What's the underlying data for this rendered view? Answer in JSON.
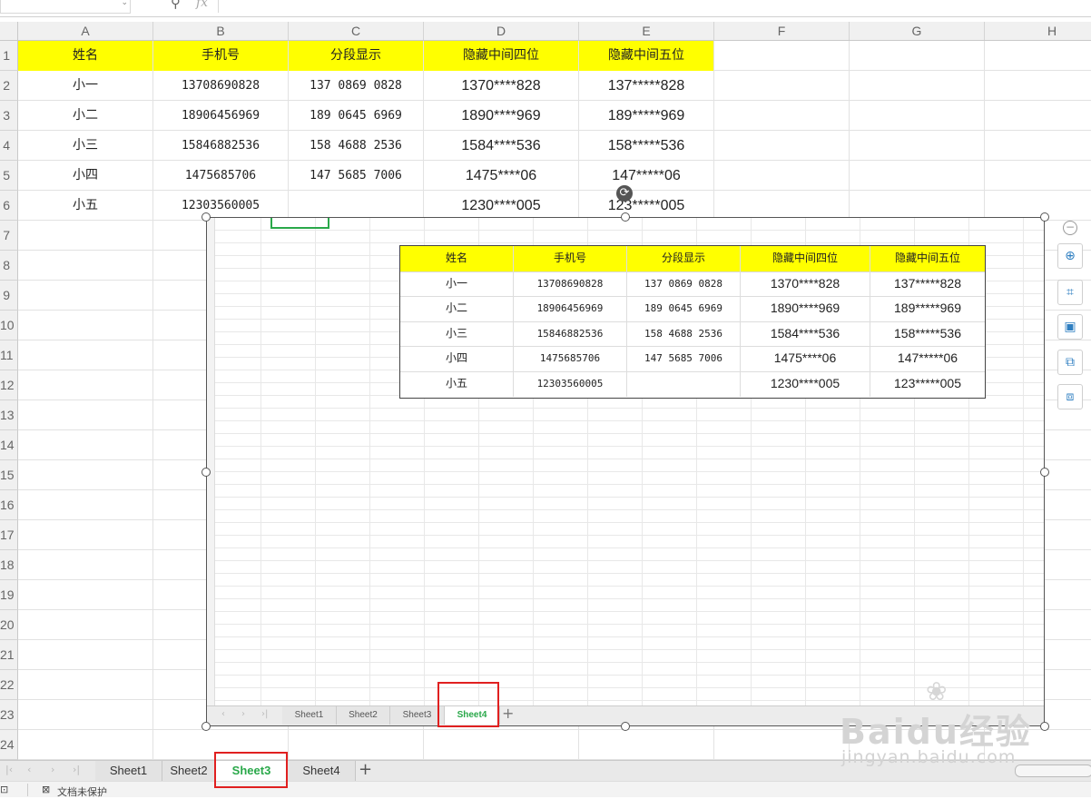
{
  "formula_bar": {
    "fx": "fx"
  },
  "columns": [
    "A",
    "B",
    "C",
    "D",
    "E",
    "F",
    "G",
    "H"
  ],
  "rows": [
    "1",
    "2",
    "3",
    "4",
    "5",
    "6",
    "7",
    "8",
    "9",
    "10",
    "11",
    "12",
    "13",
    "14",
    "15",
    "16",
    "17",
    "18",
    "19",
    "20",
    "21",
    "22",
    "23",
    "24"
  ],
  "table": {
    "headers": [
      "姓名",
      "手机号",
      "分段显示",
      "隐藏中间四位",
      "隐藏中间五位"
    ],
    "rows": [
      [
        "小一",
        "13708690828",
        "137 0869 0828",
        "1370****828",
        "137*****828"
      ],
      [
        "小二",
        "18906456969",
        "189 0645 6969",
        "1890****969",
        "189*****969"
      ],
      [
        "小三",
        "15846882536",
        "158 4688 2536",
        "1584****536",
        "158*****536"
      ],
      [
        "小四",
        "1475685706",
        "147 5685 7006",
        "1475****06",
        "147*****06"
      ],
      [
        "小五",
        "12303560005",
        "",
        "1230****005",
        "123*****005"
      ]
    ]
  },
  "picture": {
    "tabs": [
      "Sheet1",
      "Sheet2",
      "Sheet3",
      "Sheet4"
    ],
    "active_tab": "Sheet4",
    "add_tab": "+"
  },
  "sheet_tabs": [
    "Sheet1",
    "Sheet2",
    "Sheet3",
    "Sheet4"
  ],
  "active_sheet": "Sheet3",
  "add_sheet": "+",
  "side_toolbar": {
    "collapse": "−",
    "icons": [
      "zoom-in-icon",
      "crop-icon",
      "select-image-icon",
      "replace-image-icon",
      "image-settings-icon"
    ]
  },
  "status": {
    "protection": "文档未保护"
  },
  "watermark": {
    "brand": "Baidu经验",
    "url": "jingyan.baidu.com"
  },
  "colors": {
    "header_fill": "#ffff00",
    "active_tab": "#2aa84a",
    "highlight_box": "#e02020"
  }
}
